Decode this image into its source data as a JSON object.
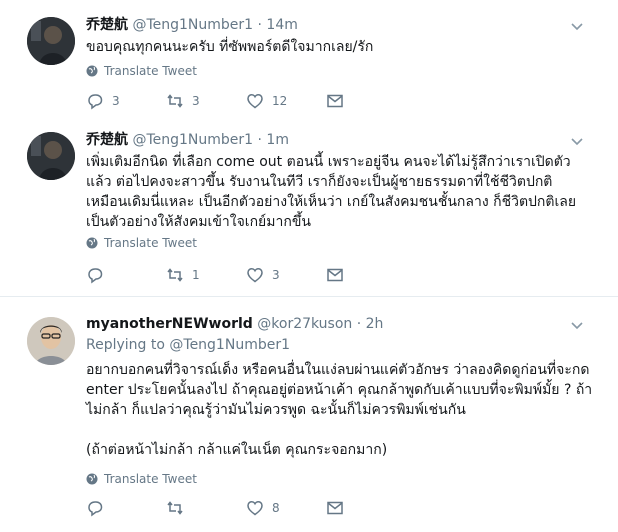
{
  "tweets": [
    {
      "name": "乔楚航",
      "handle": "@Teng1Number1",
      "time": "· 14m",
      "text": "ขอบคุณทุกคนนะครับ ที่ซัพพอร์ตดีใจมากเลย/รัก",
      "translate": "Translate Tweet",
      "replies": "3",
      "retweets": "3",
      "likes": "12"
    },
    {
      "name": "乔楚航",
      "handle": "@Teng1Number1",
      "time": "· 1m",
      "text": "เพิ่มเติมอีกนิด ที่เลือก come out ตอนนี้ เพราะอยู่จีน คนจะได้ไม่รู้สึกว่าเราเปิดตัวแล้ว ต่อไปคงจะสาวขึ้น รับงานในทีวี เราก็ยังจะเป็นผู้ชายธรรมดาที่ใช้ชีวิตปกติ เหมือนเดิมนี่แหละ เป็นอีกตัวอย่างให้เห็นว่า เกย์ในสังคมชนชั้นกลาง ก็ชีวิตปกติเลย เป็นตัวอย่างให้สังคมเข้าใจเกย์มากขึ้น",
      "translate": "Translate Tweet",
      "replies": "",
      "retweets": "1",
      "likes": "3"
    },
    {
      "name": "myanotherNEWworld",
      "handle": "@kor27kuson",
      "time": "· 2h",
      "replying_label": "Replying to",
      "replying_handle": "@Teng1Number1",
      "text": "อยากบอกคนที่วิจารณ์เด็ง หรือคนอื่นในแง่ลบผ่านแค่ตัวอักษร ว่าลองคิดดูก่อนที่จะกด enter ประโยคนั้นลงไป ถ้าคุณอยู่ต่อหน้าเค้า คุณกล้าพูดกับเค้าแบบที่จะพิมพ์มั้ย ? ถ้าไม่กล้า ก็แปลว่าคุณรู้ว่ามันไม่ควรพูด ฉะนั้นก็ไม่ควรพิมพ์เช่นกัน",
      "text2": "(ถ้าต่อหน้าไม่กล้า กล้าแค่ในเน็ต คุณกระจอกมาก)",
      "translate": "Translate Tweet",
      "replies": "",
      "retweets": "",
      "likes": "8"
    }
  ],
  "icons": {
    "reply": "reply-icon",
    "retweet": "retweet-icon",
    "like": "heart-icon",
    "dm": "message-icon",
    "caret": "chevron-down-icon",
    "globe": "globe-icon"
  },
  "colors": {
    "text": "#14171a",
    "meta": "#657786",
    "divider": "#e6ecf0"
  }
}
